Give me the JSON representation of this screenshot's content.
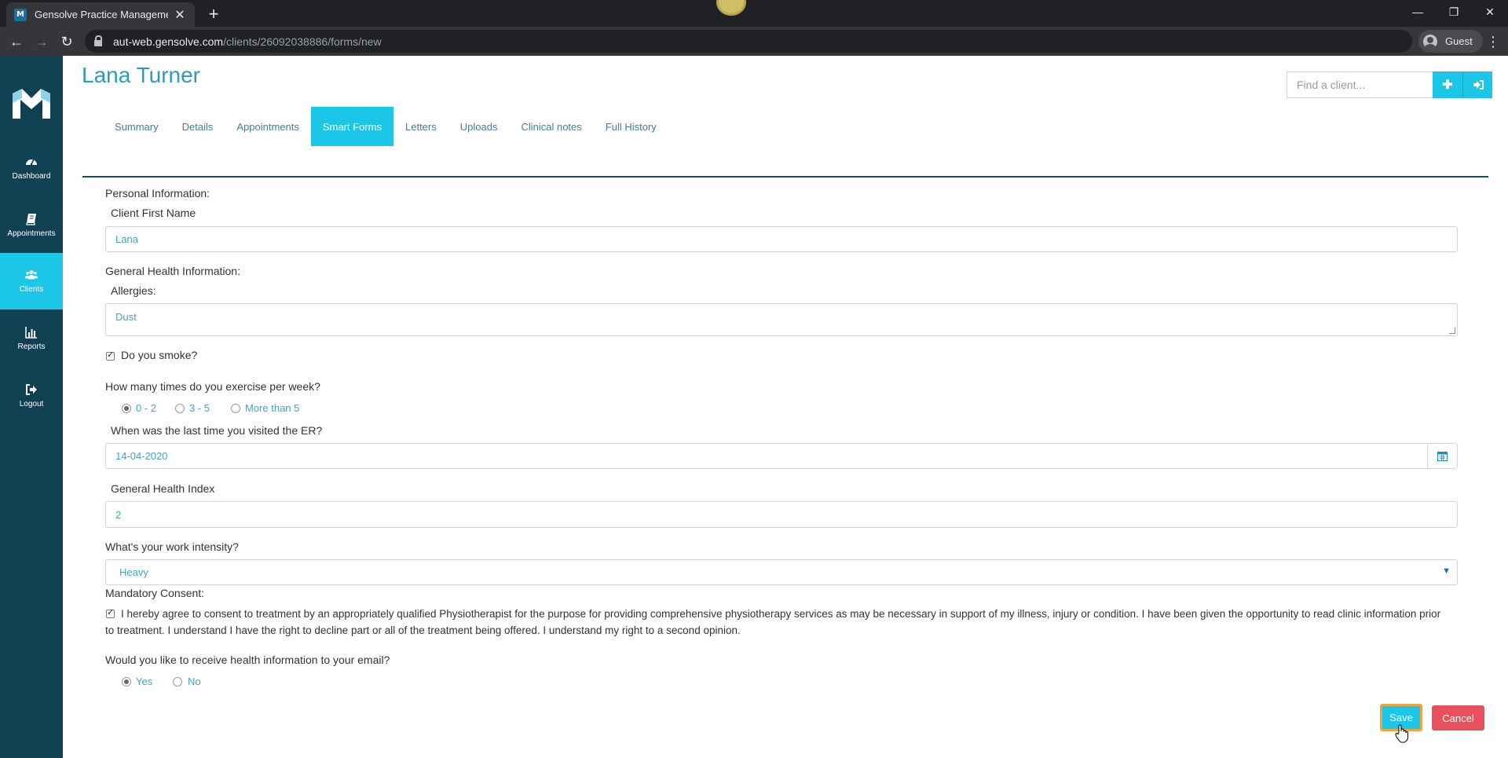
{
  "browser": {
    "tab_title": "Gensolve Practice Management",
    "url_host": "aut-web.gensolve.com",
    "url_path": "/clients/26092038886/forms/new",
    "profile_label": "Guest"
  },
  "sidebar": {
    "items": [
      {
        "label": "Dashboard",
        "icon": "dashboard-icon"
      },
      {
        "label": "Appointments",
        "icon": "book-icon"
      },
      {
        "label": "Clients",
        "icon": "users-icon",
        "active": true
      },
      {
        "label": "Reports",
        "icon": "bar-chart-icon"
      },
      {
        "label": "Logout",
        "icon": "sign-out-icon"
      }
    ]
  },
  "header": {
    "client_name": "Lana Turner",
    "search_placeholder": "Find a client..."
  },
  "tabs": [
    "Summary",
    "Details",
    "Appointments",
    "Smart Forms",
    "Letters",
    "Uploads",
    "Clinical notes",
    "Full History"
  ],
  "active_tab": "Smart Forms",
  "form": {
    "personal_section": "Personal Information:",
    "first_name_label": "Client First Name",
    "first_name_value": "Lana",
    "health_section": "General Health Information:",
    "allergies_label": "Allergies:",
    "allergies_value": "Dust",
    "smoke_label": "Do you smoke?",
    "smoke_checked": true,
    "exercise_label": "How many times do you exercise per week?",
    "exercise_options": [
      "0 - 2",
      "3 - 5",
      "More than 5"
    ],
    "exercise_selected": "0 - 2",
    "er_label": "When was the last time you visited the ER?",
    "er_value": "14-04-2020",
    "health_index_label": "General Health Index",
    "health_index_value": "2",
    "work_label": "What's your work intensity?",
    "work_value": "Heavy",
    "consent_section": "Mandatory Consent:",
    "consent_checked": true,
    "consent_text": "I hereby agree to consent to treatment by an appropriately qualified Physiotherapist for the purpose for providing comprehensive physiotherapy services as may be necessary in support of my illness, injury or condition. I have been given the opportunity to read clinic information prior to treatment. I understand I have the right to decline part or all of the treatment being offered. I understand my right to a second opinion.",
    "email_label": "Would you like to receive health information to your email?",
    "email_options": [
      "Yes",
      "No"
    ],
    "email_selected": "Yes"
  },
  "actions": {
    "save_label": "Save",
    "cancel_label": "Cancel"
  },
  "colors": {
    "accent": "#1bc6e6",
    "sidebar": "#0f4152",
    "cancel": "#e8505b",
    "title": "#2b9bbf"
  }
}
